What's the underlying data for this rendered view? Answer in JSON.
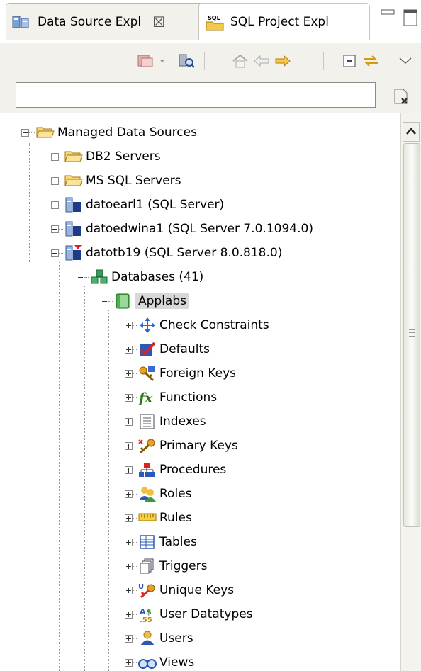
{
  "tabs": [
    {
      "label": "Data Source Expl",
      "active": true,
      "icon": "data-source-icon",
      "close": "☒"
    },
    {
      "label": "SQL Project Expl",
      "active": false,
      "icon": "sql-project-icon",
      "icon_text": "SQL"
    }
  ],
  "toolbar": {
    "buttons": [
      "new-connection-icon",
      "dropdown-arrow-icon",
      "filter-icon",
      "home-icon",
      "back-icon",
      "forward-icon",
      "collapse-all-icon",
      "link-with-editor-icon",
      "view-menu-icon"
    ]
  },
  "filter": {
    "value": "",
    "placeholder": ""
  },
  "tree": {
    "root": "Managed Data Sources",
    "db2": "DB2 Servers",
    "mssql": "MS SQL Servers",
    "conn1": "datoearl1 (SQL Server)",
    "conn2": "datoedwina1 (SQL Server 7.0.1094.0)",
    "conn3": "datotb19 (SQL Server 8.0.818.0)",
    "databases": "Databases (41)",
    "db": "Applabs",
    "children": [
      {
        "label": "Check Constraints",
        "icon": "check-constraints-icon"
      },
      {
        "label": "Defaults",
        "icon": "defaults-icon"
      },
      {
        "label": "Foreign Keys",
        "icon": "foreign-keys-icon"
      },
      {
        "label": "Functions",
        "icon": "functions-icon"
      },
      {
        "label": "Indexes",
        "icon": "indexes-icon"
      },
      {
        "label": "Primary Keys",
        "icon": "primary-keys-icon"
      },
      {
        "label": "Procedures",
        "icon": "procedures-icon"
      },
      {
        "label": "Roles",
        "icon": "roles-icon"
      },
      {
        "label": "Rules",
        "icon": "rules-icon"
      },
      {
        "label": "Tables",
        "icon": "tables-icon"
      },
      {
        "label": "Triggers",
        "icon": "triggers-icon"
      },
      {
        "label": "Unique Keys",
        "icon": "unique-keys-icon"
      },
      {
        "label": "User Datatypes",
        "icon": "user-datatypes-icon"
      },
      {
        "label": "Users",
        "icon": "users-icon"
      },
      {
        "label": "Views",
        "icon": "views-icon"
      }
    ]
  },
  "colors": {
    "folder": "#f3c94a",
    "selection": "#d8d8d8",
    "accent_green": "#3aa04a",
    "accent_blue": "#3a6fd0"
  }
}
